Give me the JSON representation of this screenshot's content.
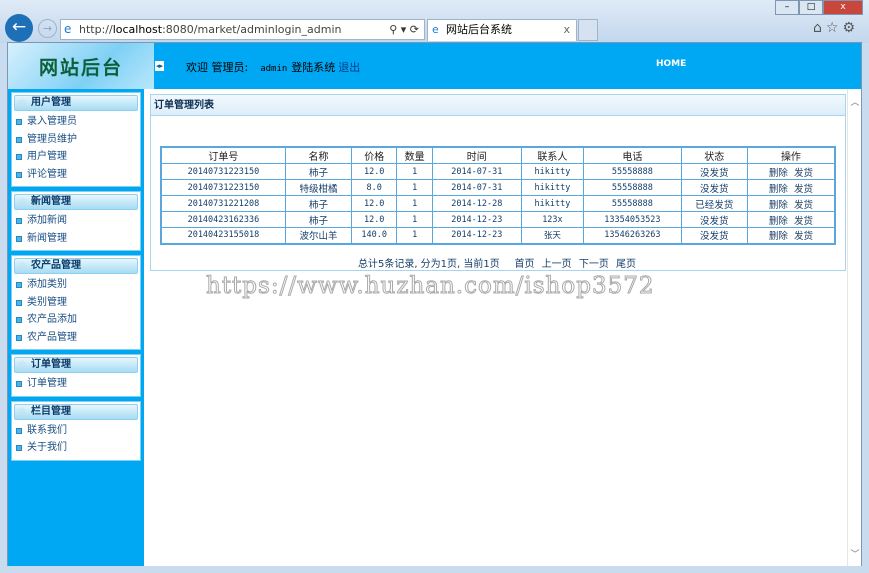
{
  "browser": {
    "url_prefix": "http://",
    "url_host": "localhost",
    "url_rest": ":8080/market/adminlogin_admin",
    "tab_title": "网站后台系统",
    "tab_close": "x",
    "min": "–",
    "max": "□",
    "close": "x"
  },
  "header": {
    "logo": "网站后台",
    "welcome": "欢迎 管理员:",
    "user": "admin",
    "login_text": "登陆系统",
    "logout": "退出",
    "home": "HOME"
  },
  "sidebar": [
    {
      "title": "用户管理",
      "items": [
        "录入管理员",
        "管理员维护",
        "用户管理",
        "评论管理"
      ]
    },
    {
      "title": "新闻管理",
      "items": [
        "添加新闻",
        "新闻管理"
      ]
    },
    {
      "title": "农产品管理",
      "items": [
        "添加类别",
        "类别管理",
        "农产品添加",
        "农产品管理"
      ]
    },
    {
      "title": "订单管理",
      "items": [
        "订单管理"
      ]
    },
    {
      "title": "栏目管理",
      "items": [
        "联系我们",
        "关于我们"
      ]
    }
  ],
  "panel": {
    "title": "订单管理列表"
  },
  "table": {
    "headers": [
      "订单号",
      "名称",
      "价格",
      "数量",
      "时间",
      "联系人",
      "电话",
      "状态",
      "操作"
    ],
    "rows": [
      [
        "20140731223150",
        "柿子",
        "12.0",
        "1",
        "2014-07-31",
        "hikitty",
        "55558888",
        "没发货"
      ],
      [
        "20140731223150",
        "特级柑橘",
        "8.0",
        "1",
        "2014-07-31",
        "hikitty",
        "55558888",
        "没发货"
      ],
      [
        "20140731221208",
        "柿子",
        "12.0",
        "1",
        "2014-12-28",
        "hikitty",
        "55558888",
        "已经发货"
      ],
      [
        "20140423162336",
        "柿子",
        "12.0",
        "1",
        "2014-12-23",
        "123x",
        "13354053523",
        "没发货"
      ],
      [
        "20140423155018",
        "波尔山羊",
        "140.0",
        "1",
        "2014-12-23",
        "张天",
        "13546263263",
        "没发货"
      ]
    ],
    "delete_label": "删除",
    "ship_label": "发货"
  },
  "pager": {
    "summary": "总计5条记录, 分为1页, 当前1页",
    "first": "首页",
    "prev": "上一页",
    "next": "下一页",
    "last": "尾页"
  },
  "watermark": "https://www.huzhan.com/ishop3572"
}
